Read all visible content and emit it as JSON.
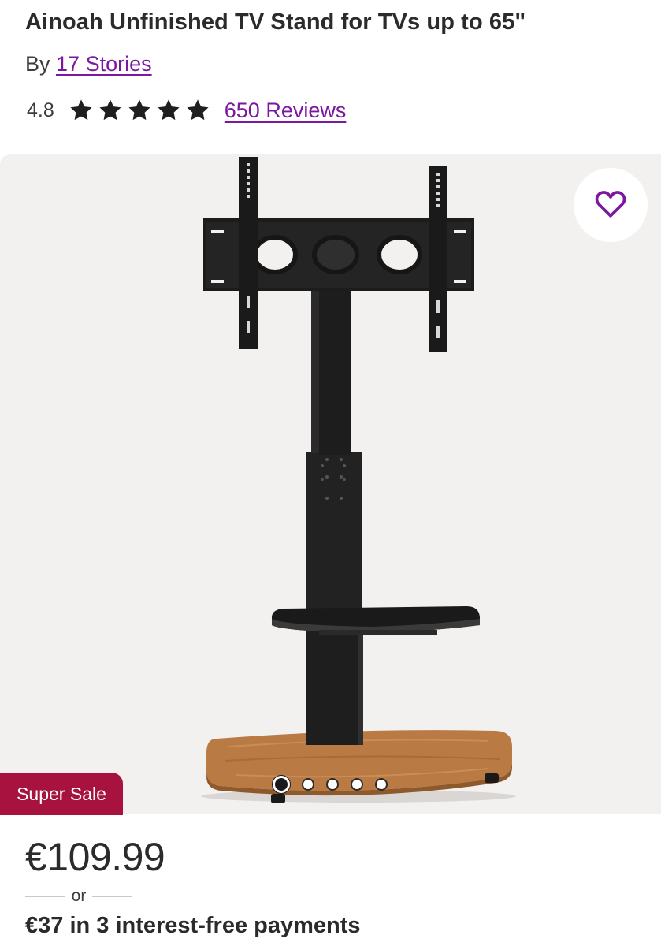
{
  "product": {
    "title": "Ainoah Unfinished TV Stand for TVs up to 65\"",
    "by_prefix": "By",
    "brand": "17 Stories",
    "rating_value": "4.8",
    "rating_stars": 5,
    "reviews_link": "650 Reviews"
  },
  "gallery": {
    "favorite_icon": "heart-icon",
    "sale_badge": "Super Sale",
    "dots_total": 5,
    "active_dot": 1
  },
  "pricing": {
    "price": "€109.99",
    "or_label": "or",
    "installments": "€37 in 3 interest-free payments"
  },
  "colors": {
    "link": "#7b189f",
    "sale_badge": "#a8123e",
    "gallery_bg": "#f2f1f0",
    "text": "#2b2b2b"
  }
}
